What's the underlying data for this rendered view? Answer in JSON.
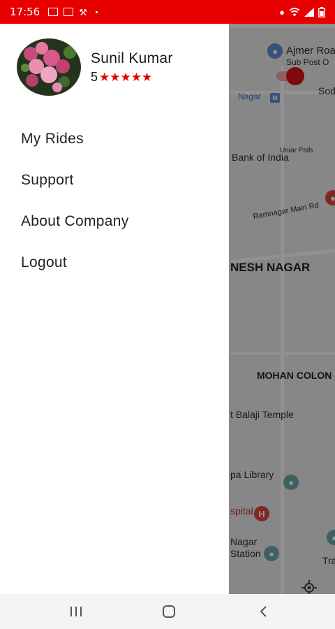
{
  "status_bar": {
    "time": "17:56",
    "icons": [
      "image-icon",
      "laptop-icon",
      "tool-icon",
      "dot-icon",
      "location-icon",
      "wifi-icon",
      "signal-icon",
      "battery-icon"
    ]
  },
  "map": {
    "labels": {
      "ajmer_road": "Ajmer Roa",
      "ajmer_road_sub": "Sub Post O",
      "sodala": "Sod",
      "metro": "Nagar",
      "bank": "Bank of India",
      "uniara": "Uniar Path",
      "ramnagar": "Ramnagar Main Rd",
      "ganesh_nagar": "NESH NAGAR",
      "mohan_colony": "MOHAN COLON",
      "balaji": "t Balaji Temple",
      "library": "pa Library",
      "hospital": "spital",
      "station_a": "Nagar",
      "station_b": "Station",
      "tra": "Tra"
    },
    "toggle_on": true,
    "colors": {
      "accent": "#e60000",
      "shade": "rgba(0,0,0,0.42)"
    }
  },
  "profile": {
    "name": "Sunil Kumar",
    "rating": "5",
    "stars": 5
  },
  "menu": {
    "items": [
      {
        "label": "My Rides"
      },
      {
        "label": "Support"
      },
      {
        "label": "About Company"
      },
      {
        "label": "Logout"
      }
    ]
  },
  "nav_bar": {
    "buttons": [
      "recent-apps",
      "home",
      "back"
    ]
  }
}
